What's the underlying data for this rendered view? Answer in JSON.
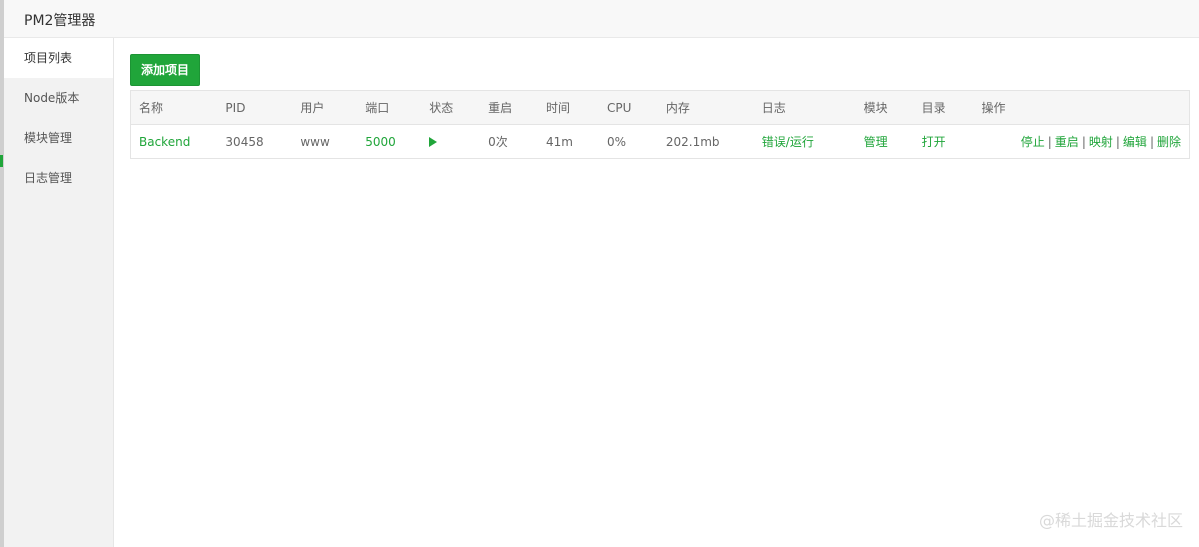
{
  "window": {
    "title": "PM2管理器"
  },
  "sidebar": {
    "items": [
      {
        "label": "项目列表",
        "active": true
      },
      {
        "label": "Node版本"
      },
      {
        "label": "模块管理"
      },
      {
        "label": "日志管理"
      }
    ]
  },
  "main": {
    "add_button": "添加项目"
  },
  "table": {
    "headers": [
      "名称",
      "PID",
      "用户",
      "端口",
      "状态",
      "重启",
      "时间",
      "CPU",
      "内存",
      "日志",
      "模块",
      "目录",
      "操作"
    ],
    "rows": [
      {
        "name": "Backend",
        "pid": "30458",
        "user": "www",
        "port": "5000",
        "status": "running",
        "restarts": "0次",
        "uptime": "41m",
        "cpu": "0%",
        "memory": "202.1mb",
        "log": "错误/运行",
        "module": "管理",
        "dir": "打开",
        "ops": [
          "停止",
          "重启",
          "映射",
          "编辑",
          "删除"
        ]
      }
    ]
  },
  "watermark": "@稀土掘金技术社区",
  "colors": {
    "accent": "#20a53a",
    "sidebar_bg": "#f2f2f2"
  },
  "icons": {
    "status": "play-triangle-icon"
  }
}
